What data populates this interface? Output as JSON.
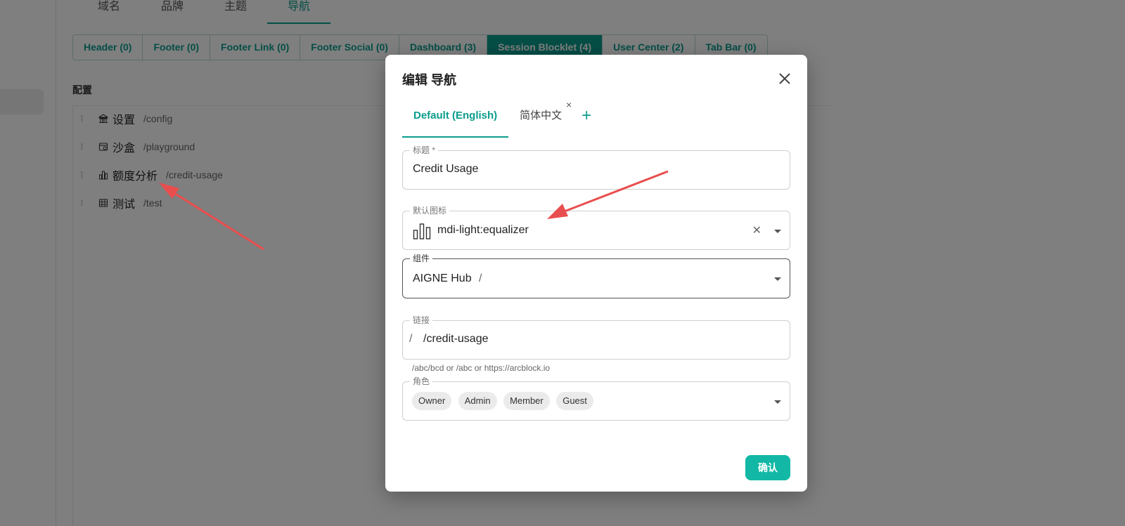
{
  "top_tabs": [
    "域名",
    "品牌",
    "主题",
    "导航"
  ],
  "chip_tabs": [
    "Header (0)",
    "Footer (0)",
    "Footer Link (0)",
    "Footer Social (0)",
    "Dashboard (3)",
    "Session Blocklet (4)",
    "User Center (2)",
    "Tab Bar (0)"
  ],
  "section_label": "配置",
  "nav_items": [
    {
      "title": "设置",
      "path": "/config",
      "icon": "bank-icon"
    },
    {
      "title": "沙盒",
      "path": "/playground",
      "icon": "sandbox-icon"
    },
    {
      "title": "额度分析",
      "path": "/credit-usage",
      "icon": "equalizer-icon"
    },
    {
      "title": "测试",
      "path": "/test",
      "icon": "grid-icon"
    }
  ],
  "dialog": {
    "title": "编辑 导航",
    "lang_tabs": [
      "Default (English)",
      "简体中文"
    ],
    "tab_remove": "×",
    "add_lang": "+",
    "fields": {
      "title_label": "标题 *",
      "title_value": "Credit Usage",
      "icon_label": "默认图标",
      "icon_value": "mdi-light:equalizer",
      "component_label": "组件",
      "component_value": "AIGNE Hub",
      "component_suffix": "/",
      "link_label": "链接",
      "link_prefix": "/",
      "link_value": "/credit-usage",
      "link_helper": "/abc/bcd or /abc or https://arcblock.io",
      "role_label": "角色",
      "roles": [
        "Owner",
        "Admin",
        "Member",
        "Guest"
      ]
    },
    "confirm_label": "确认"
  },
  "colors": {
    "accent": "#0a9d8c",
    "confirm": "#12b8a5",
    "annotation": "#e94e4e"
  }
}
